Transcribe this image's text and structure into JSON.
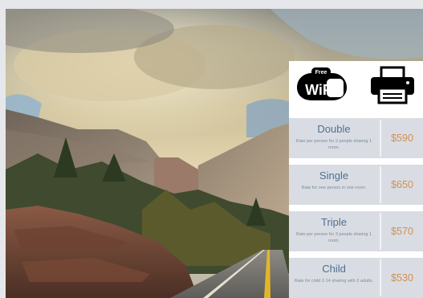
{
  "amenities": {
    "wifi_badge_text": "Free",
    "wifi_logo_text": "WiFi"
  },
  "rates": [
    {
      "name": "Double",
      "note": "Rate per person for 2 people sharing 1 room.",
      "price": "$590"
    },
    {
      "name": "Single",
      "note": "Rate for one person in one room.",
      "price": "$650"
    },
    {
      "name": "Triple",
      "note": "Rate per person for 3 people sharing 1 room.",
      "price": "$570"
    },
    {
      "name": "Child",
      "note": "Rate for child 2-14 sharing with 2 adults.",
      "price": "$530"
    }
  ],
  "colors": {
    "background": "#e6e7ea",
    "row_background": "#d9dde3",
    "room_name": "#4f6f91",
    "price": "#d38f52"
  }
}
